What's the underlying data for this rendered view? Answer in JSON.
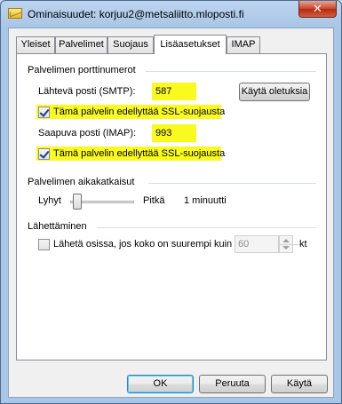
{
  "window": {
    "title": "Ominaisuudet: korjuu2@metsaliitto.mloposti.fi",
    "close_glyph": "✕"
  },
  "tabs": [
    {
      "label": "Yleiset",
      "active": false
    },
    {
      "label": "Palvelimet",
      "active": false
    },
    {
      "label": "Suojaus",
      "active": false
    },
    {
      "label": "Lisäasetukset",
      "active": true
    },
    {
      "label": "IMAP",
      "active": false
    }
  ],
  "ports": {
    "group_title": "Palvelimen porttinumerot",
    "smtp_label": "Lähtevä posti (SMTP):",
    "smtp_value": "587",
    "use_defaults_button": "Käytä oletuksia",
    "smtp_ssl_label": "Tämä palvelin edellyttää SSL-suojausta",
    "smtp_ssl_checked": true,
    "imap_label": "Saapuva posti (IMAP):",
    "imap_value": "993",
    "imap_ssl_label": "Tämä palvelin edellyttää SSL-suojausta",
    "imap_ssl_checked": true
  },
  "timeouts": {
    "group_title": "Palvelimen aikakatkaisut",
    "short_label": "Lyhyt",
    "long_label": "Pitkä",
    "value_label": "1 minuutti",
    "slider_level": 0.05
  },
  "sending": {
    "group_title": "Lähettäminen",
    "split_label": "Lähetä osissa, jos koko on suurempi kuin",
    "split_checked": false,
    "split_value": "60",
    "unit_label": "kt"
  },
  "buttons": {
    "ok": "OK",
    "cancel": "Peruuta",
    "apply": "Käytä"
  },
  "colors": {
    "highlight": "#fafa1e",
    "window_frame": "#a9c6e6"
  }
}
